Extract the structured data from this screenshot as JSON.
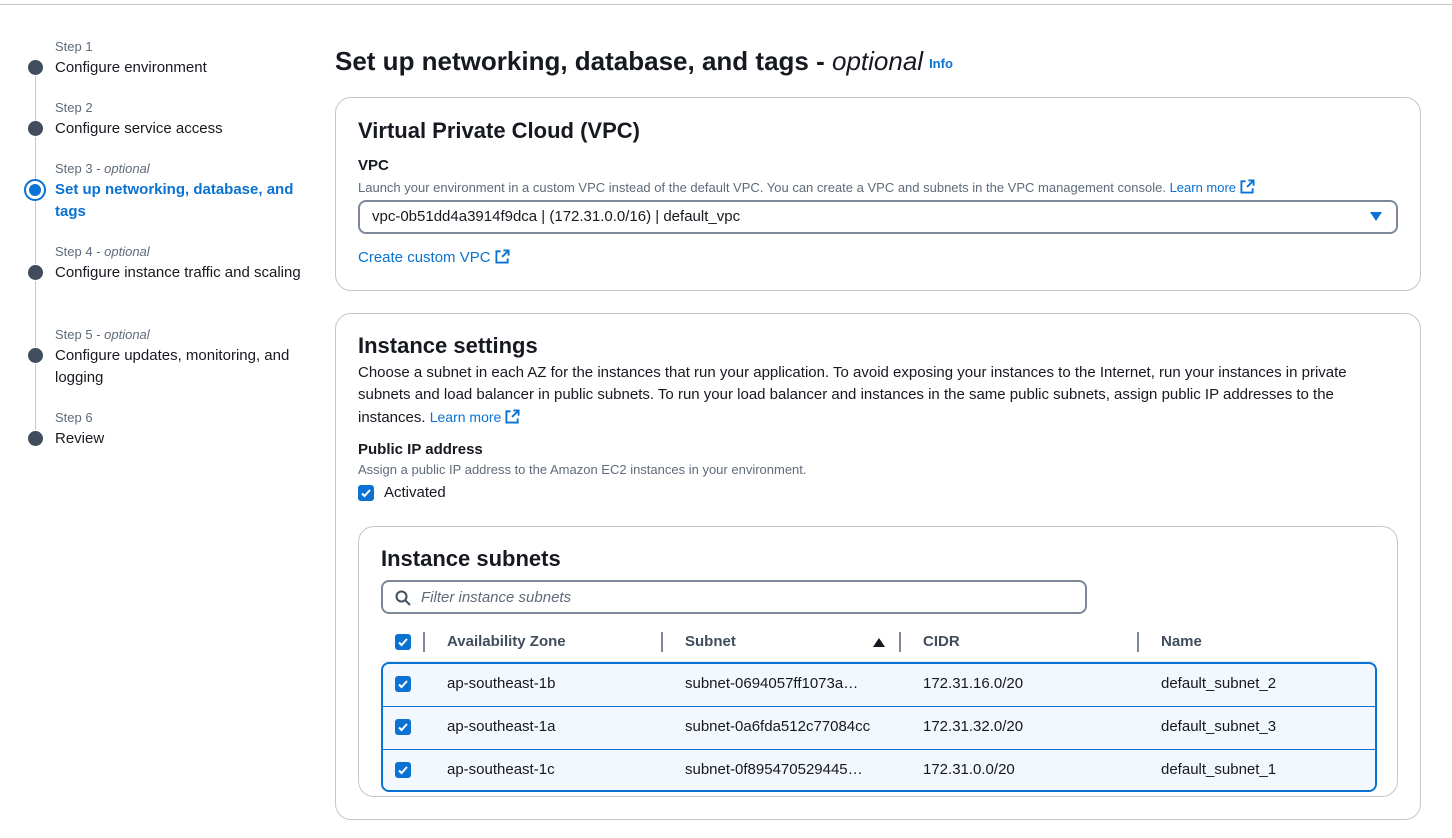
{
  "wizard": {
    "steps": [
      {
        "step": "Step 1",
        "optional": "",
        "title": "Configure environment"
      },
      {
        "step": "Step 2",
        "optional": "",
        "title": "Configure service access"
      },
      {
        "step": "Step 3 - ",
        "optional": "optional",
        "title": "Set up networking, database, and tags"
      },
      {
        "step": "Step 4 - ",
        "optional": "optional",
        "title": "Configure instance traffic and scaling"
      },
      {
        "step": "Step 5 - ",
        "optional": "optional",
        "title": "Configure updates, monitoring, and logging"
      },
      {
        "step": "Step 6",
        "optional": "",
        "title": "Review"
      }
    ]
  },
  "page": {
    "title": "Set up networking, database, and tags - ",
    "title_optional": "optional",
    "info": "Info"
  },
  "vpc": {
    "title": "Virtual Private Cloud (VPC)",
    "label": "VPC",
    "description": "Launch your environment in a custom VPC instead of the default VPC. You can create a VPC and subnets in the VPC management console.",
    "learn_more": "Learn more",
    "selected": "vpc-0b51dd4a3914f9dca | (172.31.0.0/16) | default_vpc",
    "create_custom": "Create custom VPC"
  },
  "instance_settings": {
    "title": "Instance settings",
    "description": "Choose a subnet in each AZ for the instances that run your application. To avoid exposing your instances to the Internet, run your instances in private subnets and load balancer in public subnets. To run your load balancer and instances in the same public subnets, assign public IP addresses to the instances.",
    "learn_more": "Learn more",
    "public_ip_label": "Public IP address",
    "public_ip_description": "Assign a public IP address to the Amazon EC2 instances in your environment.",
    "activated_label": "Activated"
  },
  "subnets": {
    "title": "Instance subnets",
    "filter_placeholder": "Filter instance subnets",
    "columns": [
      "Availability Zone",
      "Subnet",
      "CIDR",
      "Name"
    ],
    "rows": [
      {
        "az": "ap-southeast-1b",
        "subnet": "subnet-0694057ff1073a…",
        "cidr": "172.31.16.0/20",
        "name": "default_subnet_2"
      },
      {
        "az": "ap-southeast-1a",
        "subnet": "subnet-0a6fda512c77084cc",
        "cidr": "172.31.32.0/20",
        "name": "default_subnet_3"
      },
      {
        "az": "ap-southeast-1c",
        "subnet": "subnet-0f895470529445…",
        "cidr": "172.31.0.0/20",
        "name": "default_subnet_1"
      }
    ]
  },
  "colors": {
    "link": "#0972d3",
    "text": "#16191f",
    "muted": "#5f6b7a",
    "selected_row": "#f2f8fd"
  }
}
